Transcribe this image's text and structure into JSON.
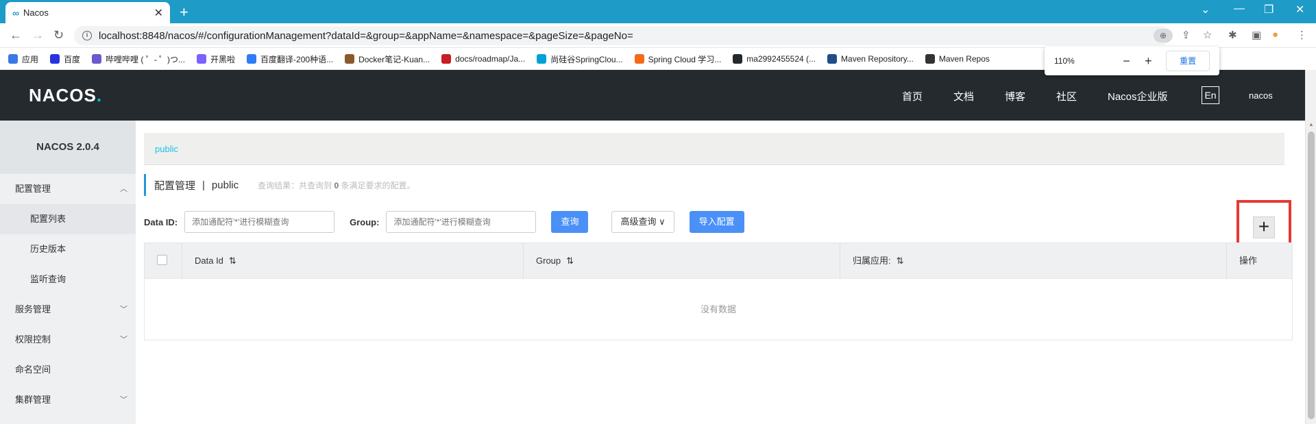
{
  "browser": {
    "tab_title": "Nacos",
    "url": "localhost:8848/nacos/#/configurationManagement?dataId=&group=&appName=&namespace=&pageSize=&pageNo=",
    "bookmarks": [
      {
        "label": "应用",
        "color": "#3b78e7"
      },
      {
        "label": "百度",
        "color": "#2932e1"
      },
      {
        "label": "哔哩哔哩 ( ゜- ゜)つ...",
        "color": "#6a5acd"
      },
      {
        "label": "开黑啦",
        "color": "#7b61ff"
      },
      {
        "label": "百度翻译-200种语...",
        "color": "#2f7cf6"
      },
      {
        "label": "Docker笔记-Kuan...",
        "color": "#8b5a2b"
      },
      {
        "label": "docs/roadmap/Ja...",
        "color": "#c71d23"
      },
      {
        "label": "尚硅谷SpringClou...",
        "color": "#00a1d6"
      },
      {
        "label": "Spring Cloud 学习...",
        "color": "#f46a1a"
      },
      {
        "label": "ma2992455524 (...",
        "color": "#24292e"
      },
      {
        "label": "Maven Repository...",
        "color": "#1e4d8c"
      },
      {
        "label": "Maven Repos",
        "color": "#333333"
      }
    ],
    "zoom": {
      "percent": "110%",
      "minus": "−",
      "plus": "+",
      "reset": "重置"
    }
  },
  "header": {
    "logo": "NACOS",
    "nav": [
      "首页",
      "文档",
      "博客",
      "社区",
      "Nacos企业版"
    ],
    "lang": "En",
    "user": "nacos"
  },
  "sidebar": {
    "version": "NACOS 2.0.4",
    "config_mgmt": "配置管理",
    "config_list": "配置列表",
    "history": "历史版本",
    "listen_query": "监听查询",
    "service_mgmt": "服务管理",
    "auth": "权限控制",
    "namespace": "命名空间",
    "cluster": "集群管理"
  },
  "main": {
    "namespace_tab": "public",
    "page_title": "配置管理",
    "page_sep": "|",
    "page_ns": "public",
    "query_hint_prefix": "查询结果：共查询到",
    "query_count": "0",
    "query_hint_suffix": "条满足要求的配置。",
    "dataid_label": "Data ID:",
    "group_label": "Group:",
    "input_placeholder": "添加通配符'*'进行模糊查询",
    "search_btn": "查询",
    "advanced_btn": "高级查询",
    "import_btn": "导入配置",
    "add_btn": "+",
    "columns": [
      "Data Id",
      "Group",
      "归属应用:",
      "操作"
    ],
    "empty": "没有数据"
  }
}
